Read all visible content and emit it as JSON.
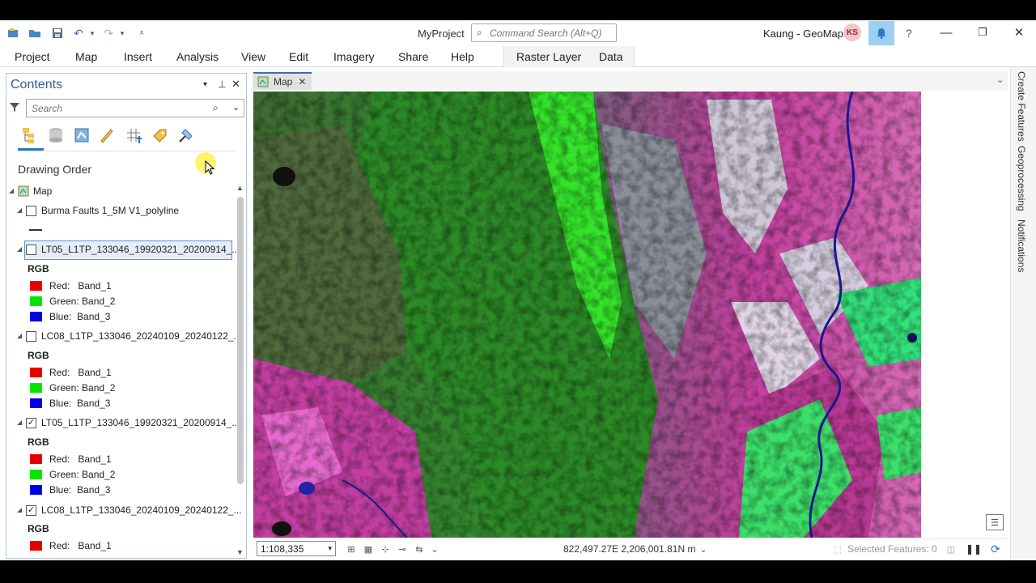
{
  "title_bar": {
    "project_name": "MyProject",
    "command_search_placeholder": "Command Search (Alt+Q)",
    "user_name": "Kaung - GeoMap",
    "avatar_initials": "KS",
    "help_label": "?"
  },
  "ribbon": {
    "tabs": [
      "Project",
      "Map",
      "Insert",
      "Analysis",
      "View",
      "Edit",
      "Imagery",
      "Share",
      "Help"
    ],
    "contextual_tabs": [
      "Raster Layer",
      "Data"
    ]
  },
  "contents": {
    "title": "Contents",
    "search_placeholder": "Search",
    "section_title": "Drawing Order",
    "map_name": "Map",
    "fault_layer": "Burma Faults 1_5M V1_polyline",
    "layers": [
      {
        "name": "LT05_L1TP_133046_19920321_20200914_...",
        "checked": false,
        "selected": true,
        "renderer": "RGB",
        "bands": [
          {
            "label": "Red:   Band_1",
            "color": "#e60000"
          },
          {
            "label": "Green: Band_2",
            "color": "#00e600"
          },
          {
            "label": "Blue:  Band_3",
            "color": "#0000e6"
          }
        ]
      },
      {
        "name": "LC08_L1TP_133046_20240109_20240122_...",
        "checked": false,
        "selected": false,
        "renderer": "RGB",
        "bands": [
          {
            "label": "Red:   Band_1",
            "color": "#e60000"
          },
          {
            "label": "Green: Band_2",
            "color": "#00e600"
          },
          {
            "label": "Blue:  Band_3",
            "color": "#0000e6"
          }
        ]
      },
      {
        "name": "LT05_L1TP_133046_19920321_20200914_...",
        "checked": true,
        "selected": false,
        "renderer": "RGB",
        "bands": [
          {
            "label": "Red:   Band_1",
            "color": "#e60000"
          },
          {
            "label": "Green: Band_2",
            "color": "#00e600"
          },
          {
            "label": "Blue:  Band_3",
            "color": "#0000e6"
          }
        ]
      },
      {
        "name": "LC08_L1TP_133046_20240109_20240122_...",
        "checked": true,
        "selected": false,
        "renderer": "RGB",
        "bands": [
          {
            "label": "Red:   Band_1",
            "color": "#e60000"
          }
        ]
      }
    ]
  },
  "map_view": {
    "tab_label": "Map",
    "scale": "1:108,335",
    "coordinates": "822,497.27E 2,206,001.81N m",
    "selected_features": "Selected Features: 0"
  },
  "side_panes": [
    "Create Features",
    "Geoprocessing",
    "Notifications"
  ],
  "colors": {
    "accent": "#2a79c9",
    "pane_title": "#2f5e95",
    "notification_bg": "#9cd0f2"
  }
}
